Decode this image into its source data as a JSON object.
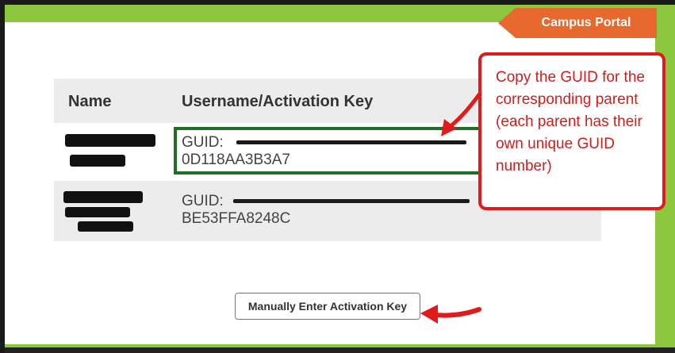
{
  "header": {
    "portal_label": "Campus Portal"
  },
  "table": {
    "columns": [
      "Name",
      "Username/Activation Key"
    ],
    "rows": [
      {
        "guid_prefix": "GUID:",
        "guid_suffix": "0D118AA3B3A7"
      },
      {
        "guid_prefix": "GUID:",
        "guid_suffix": "BE53FFA8248C"
      }
    ]
  },
  "callout": {
    "text": "Copy the GUID for the corresponding parent (each parent has their own unique GUID number)"
  },
  "actions": {
    "manual_entry_label": "Manually Enter Activation Key"
  },
  "colors": {
    "brand_green": "#8dc63f",
    "portal_orange": "#e8692e",
    "callout_red": "#e01b1b",
    "highlight_green": "#1f6e25"
  }
}
